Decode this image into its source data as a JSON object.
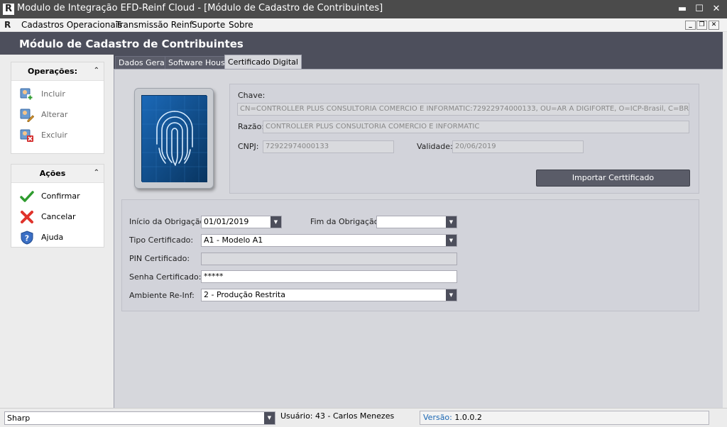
{
  "window": {
    "app_icon": "R",
    "title": "Modulo de Integração EFD-Reinf Cloud - [Módulo de Cadastro de Contribuintes]",
    "buttons": {
      "minimize": "▬",
      "maximize": "☐",
      "close": "✕"
    }
  },
  "menubar": {
    "icon": "R",
    "items": [
      "Cadastros Operacionais",
      "Transmissão Reinf",
      "Suporte",
      "Sobre"
    ],
    "mdi_buttons": {
      "minimize": "_",
      "restore": "❐",
      "close": "✕"
    }
  },
  "module_title": "Módulo de Cadastro de Contribuintes",
  "sidebar": {
    "operacoes": {
      "title": "Operações:",
      "collapse_icon": "⌃",
      "items": [
        {
          "label": "Incluir",
          "icon": "add-user-icon"
        },
        {
          "label": "Alterar",
          "icon": "edit-user-icon"
        },
        {
          "label": "Excluir",
          "icon": "delete-user-icon"
        }
      ]
    },
    "acoes": {
      "title": "Ações",
      "collapse_icon": "⌃",
      "items": [
        {
          "label": "Confirmar",
          "icon": "check-icon"
        },
        {
          "label": "Cancelar",
          "icon": "cross-icon"
        },
        {
          "label": "Ajuda",
          "icon": "help-shield-icon"
        }
      ]
    }
  },
  "tabs": [
    {
      "label": "Dados Gerais",
      "active": false
    },
    {
      "label": "Software House",
      "active": false
    },
    {
      "label": "Certificado Digital",
      "active": true
    }
  ],
  "certificate": {
    "image_icon": "fingerprint-tablet-icon",
    "chave_label": "Chave:",
    "chave_value": "CN=CONTROLLER PLUS CONSULTORIA COMERCIO E INFORMATIC:72922974000133, OU=AR A DIGIFORTE, O=ICP-Brasil, C=BR, S=SP",
    "razao_label": "Razão:",
    "razao_value": "CONTROLLER PLUS CONSULTORIA COMERCIO E INFORMATIC",
    "cnpj_label": "CNPJ:",
    "cnpj_value": "72922974000133",
    "validade_label": "Validade:",
    "validade_value": "20/06/2019",
    "import_button": "Importar Certtificado"
  },
  "form": {
    "inicio_label": "Início da Obrigação:",
    "inicio_value": "01/01/2019",
    "fim_label": "Fim da Obrigação:",
    "fim_value": "",
    "tipo_label": "Tipo Certificado:",
    "tipo_value": "A1 - Modelo A1",
    "pin_label": "PIN Certificado:",
    "pin_value": "",
    "senha_label": "Senha Certificado:",
    "senha_value": "*****",
    "ambiente_label": "Ambiente Re-Inf:",
    "ambiente_value": "2 - Produção Restrita",
    "dropdown_arrow": "▼"
  },
  "statusbar": {
    "theme_value": "Sharp",
    "user_text": "Usuário: 43 - Carlos Menezes",
    "version_label": "Versão:",
    "version_value": "1.0.0.2"
  },
  "colors": {
    "titlebar": "#4b4b4b",
    "module_header": "#4d4f5c",
    "tab_page": "#d6d7dc",
    "accent_link": "#1a66b3"
  }
}
